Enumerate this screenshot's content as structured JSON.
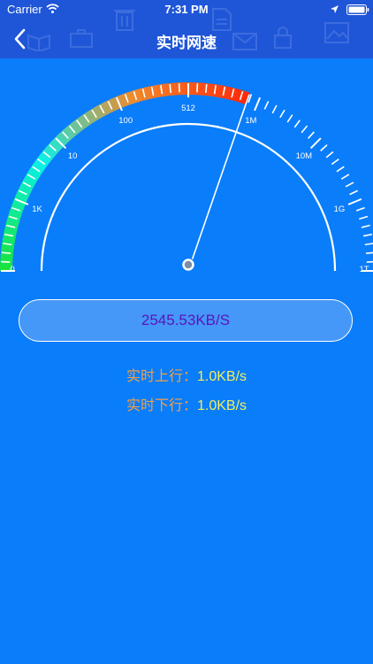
{
  "status_bar": {
    "carrier": "Carrier",
    "time": "7:31 PM"
  },
  "nav": {
    "title": "实时网速"
  },
  "gauge": {
    "scale_labels": [
      "0",
      "1K",
      "10",
      "100",
      "512",
      "1M",
      "10M",
      "1G",
      "1T"
    ],
    "gradient_colors": [
      "#18e43c",
      "#0af0e8",
      "#f08a2c",
      "#ff2a0a"
    ],
    "active_fraction": 0.606
  },
  "readout": {
    "speed": "2545.53KB/S"
  },
  "upload": {
    "label": "实时上行：",
    "value": "1.0KB/s"
  },
  "download": {
    "label": "实时下行：",
    "value": "1.0KB/s"
  }
}
